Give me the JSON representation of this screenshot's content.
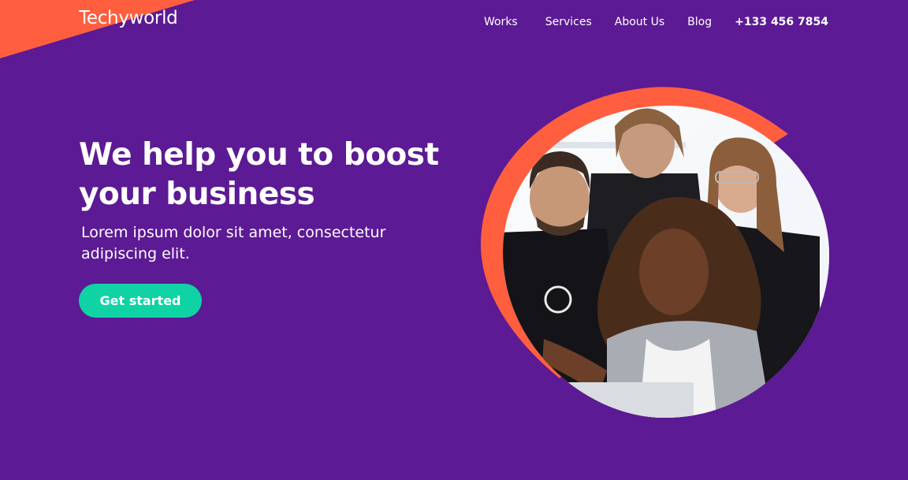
{
  "brand": {
    "name": "Techyworld"
  },
  "nav": {
    "items": [
      "Works",
      "Services",
      "About Us",
      "Blog"
    ],
    "phone": "+133 456 7854"
  },
  "hero": {
    "title": "We help you to boost your business",
    "subtitle": "Lorem ipsum dolor sit amet, consectetur adipiscing elit.",
    "cta_label": "Get started"
  },
  "colors": {
    "background": "#5c1a94",
    "accent": "#ff5f3f",
    "cta": "#0fd3a4"
  },
  "icons": {
    "hero_image": "team-photo"
  }
}
